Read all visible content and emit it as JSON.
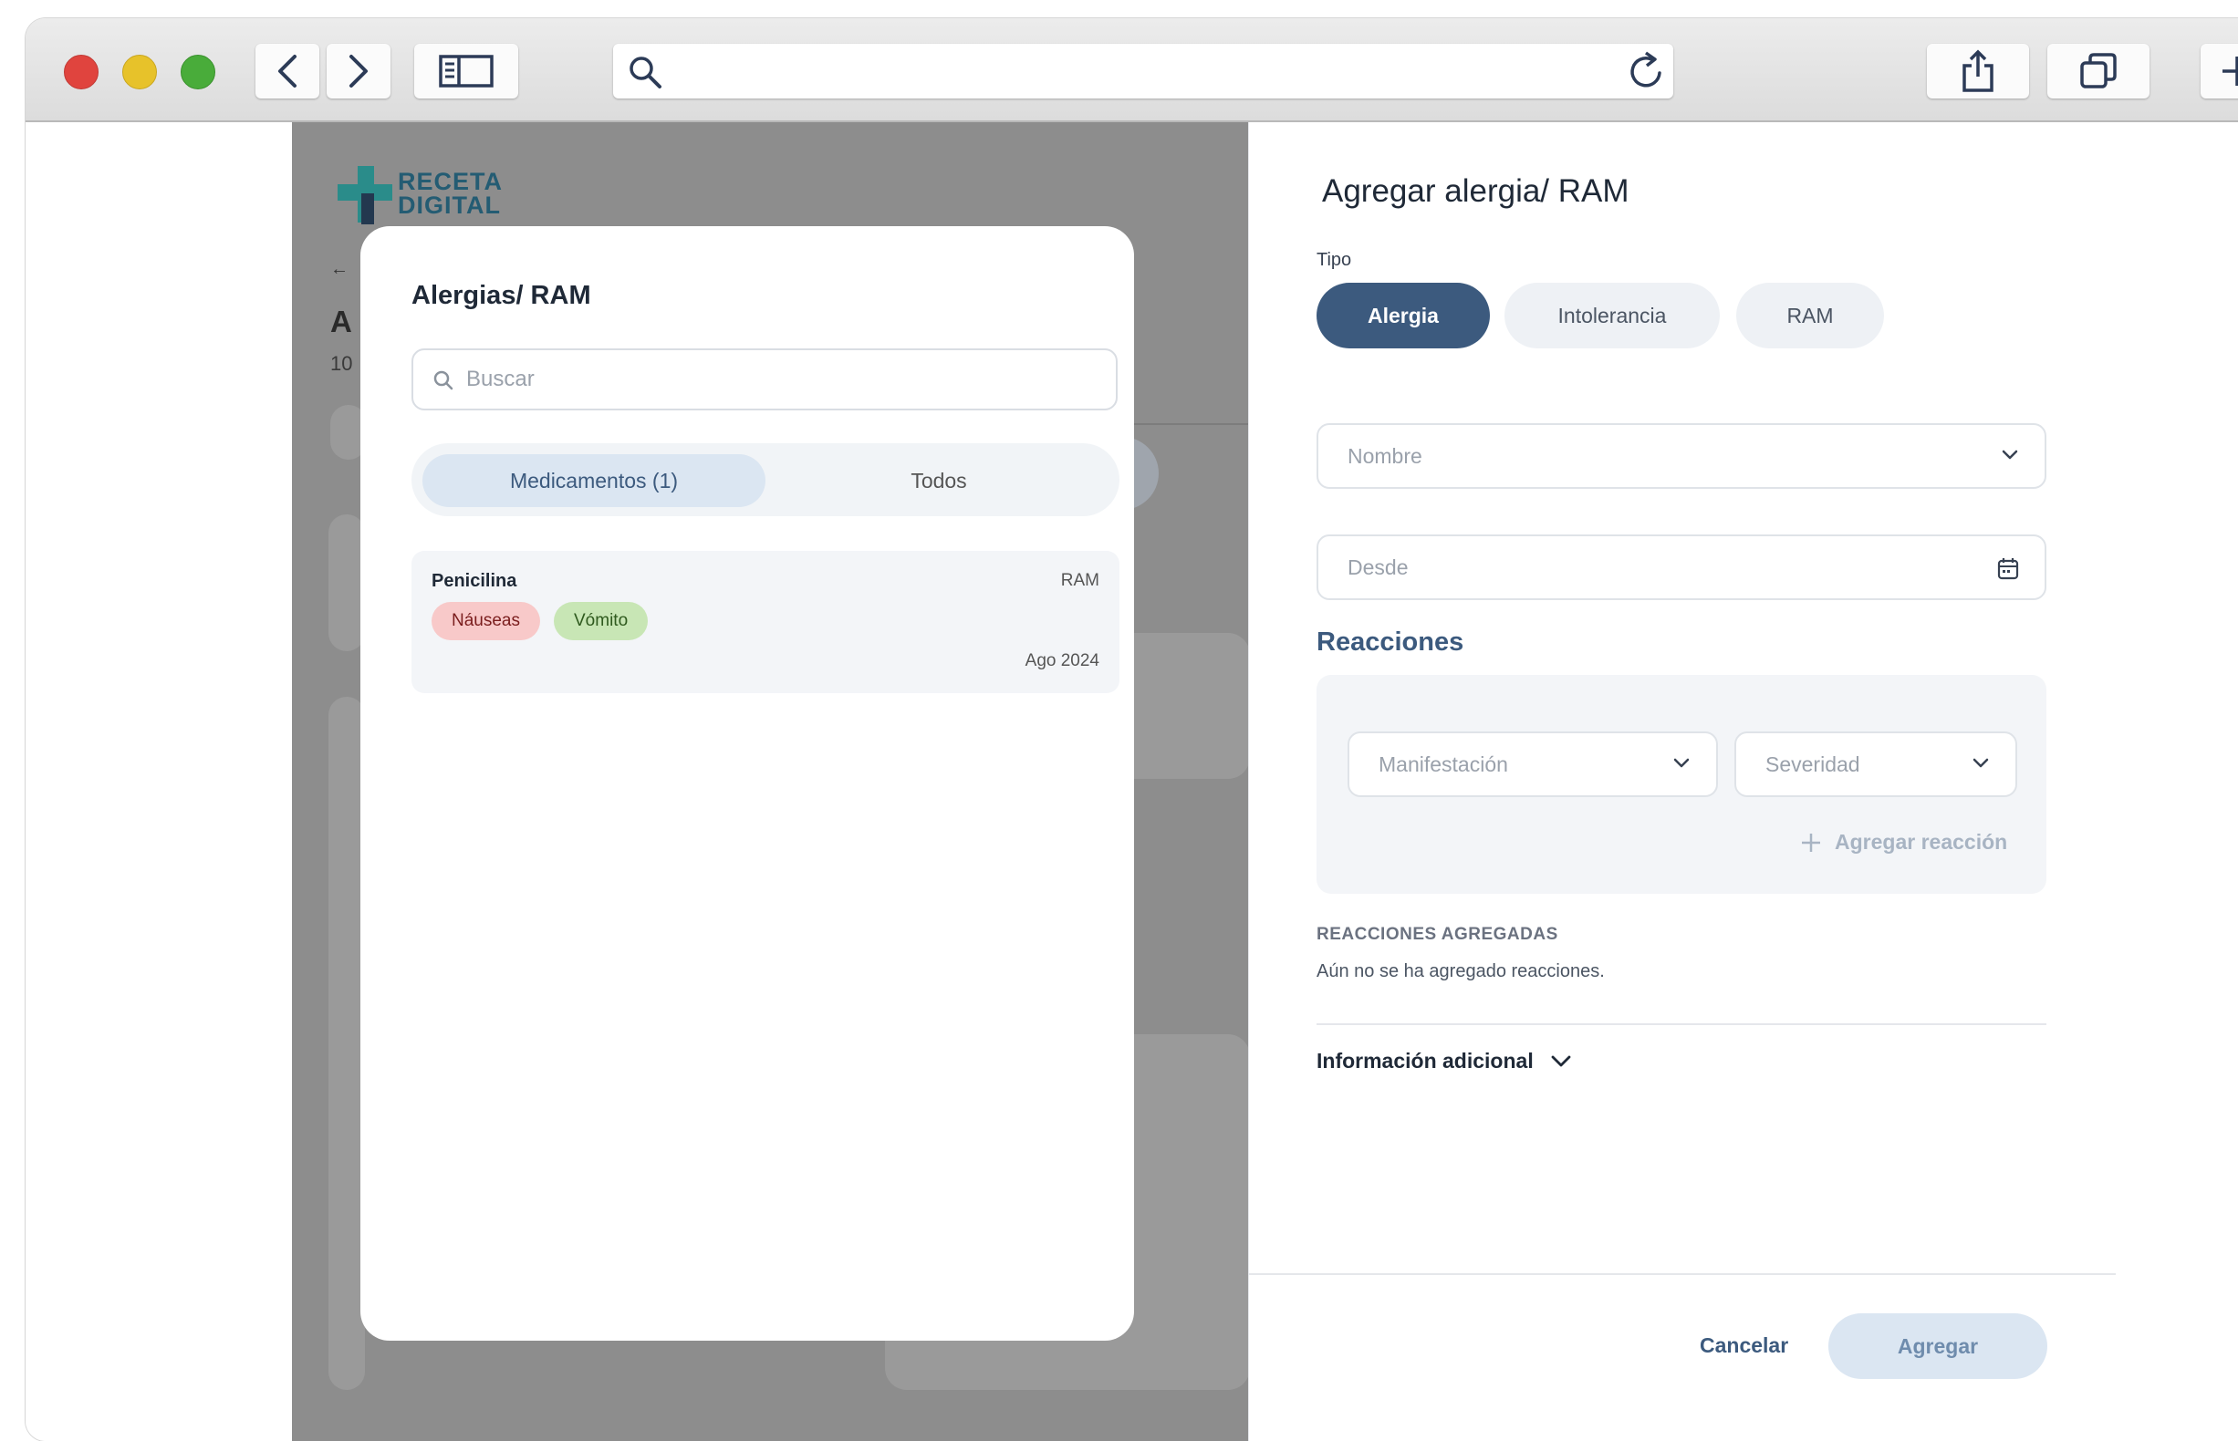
{
  "browser": {
    "traffic_lights": {
      "close": "#e0443e",
      "minimize": "#e7c22a",
      "zoom": "#49ac3a"
    },
    "icons": [
      "back-icon",
      "forward-icon",
      "sidebar-icon",
      "search-icon",
      "reload-icon",
      "share-icon",
      "tabs-icon",
      "new-tab-icon"
    ]
  },
  "background_app": {
    "logo_line1": "RECETA",
    "logo_line2": "DIGITAL",
    "back_glyph": "←",
    "heading_fragment": "A",
    "subtext_fragment": "10"
  },
  "modal": {
    "title": "Alergias/ RAM",
    "search_placeholder": "Buscar",
    "tabs": [
      {
        "label": "Medicamentos (1)",
        "active": true
      },
      {
        "label": "Todos",
        "active": false
      }
    ],
    "items": [
      {
        "name": "Penicilina",
        "type": "RAM",
        "date": "Ago 2024",
        "tags": [
          {
            "label": "Náuseas",
            "bg": "#f8c9c9",
            "fg": "#7a1d1d"
          },
          {
            "label": "Vómito",
            "bg": "#c8e6b5",
            "fg": "#2f5a1e"
          }
        ]
      }
    ]
  },
  "panel": {
    "title": "Agregar alergia/ RAM",
    "tipo_label": "Tipo",
    "tipo_options": [
      {
        "label": "Alergia",
        "active": true
      },
      {
        "label": "Intolerancia",
        "active": false
      },
      {
        "label": "RAM",
        "active": false
      }
    ],
    "nombre_placeholder": "Nombre",
    "desde_placeholder": "Desde",
    "reacciones_title": "Reacciones",
    "manifestacion_placeholder": "Manifestación",
    "severidad_placeholder": "Severidad",
    "add_reaction_label": "Agregar reacción",
    "added_title": "REACCIONES AGREGADAS",
    "added_empty": "Aún no se ha agregado reacciones.",
    "info_label": "Información adicional",
    "cancel_label": "Cancelar",
    "submit_label": "Agregar"
  },
  "colors": {
    "primary": "#3c5a7e",
    "primary_light": "#dbe6f2",
    "pill_inactive": "#eef1f5",
    "overlay": "#8d8d8d",
    "logo_teal": "#2a8c8a",
    "logo_navy": "#23384f"
  }
}
